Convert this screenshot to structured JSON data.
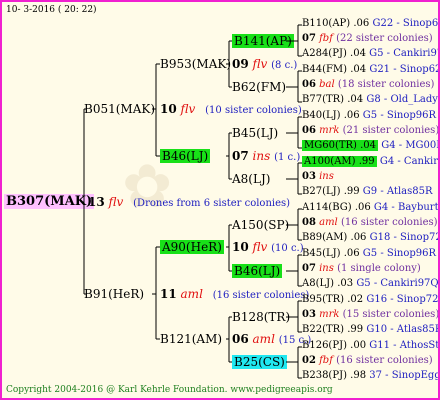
{
  "date": "10-  3-2016 ( 20: 22)",
  "root": {
    "id": "B307(MAK)",
    "num": "13",
    "code": "flv",
    "note": "(Drones from 6 sister colonies)"
  },
  "gen1": [
    {
      "id": "B051(MAK)",
      "num": "10",
      "code": "flv",
      "note": "(10 sister colonies)"
    },
    {
      "id": "B91(HeR)",
      "num": "11",
      "code": "aml",
      "note": "(16 sister colonies)"
    }
  ],
  "gen2": [
    {
      "id": "B953(MAK)",
      "num": "09",
      "code": "flv",
      "note": "(8 c.)"
    },
    {
      "id": "B46(LJ)",
      "num": "07",
      "code": "ins",
      "note": "(1 c.)"
    },
    {
      "id": "A90(HeR)",
      "num": "10",
      "code": "flv",
      "note": "(10 c.)"
    },
    {
      "id": "B121(AM)",
      "num": "06",
      "code": "aml",
      "note": "(15 c.)"
    }
  ],
  "gen3": [
    {
      "id": "B141(AP)"
    },
    {
      "id": "B62(FM)"
    },
    {
      "id": "B45(LJ)"
    },
    {
      "id": "A8(LJ)"
    },
    {
      "id": "A150(SP)"
    },
    {
      "id": "B46(LJ)"
    },
    {
      "id": "B128(TR)"
    },
    {
      "id": "B25(CS)"
    }
  ],
  "gen4": [
    {
      "l1": "B110(AP) .06",
      "l1b": "G22 - Sinop62R",
      "num": "07",
      "code": "fbf",
      "note": "(22 sister colonies)",
      "l3": "A284(PJ) .04",
      "l3b": "G5 - Cankiri97Q"
    },
    {
      "l1": "B44(FM) .04",
      "l1b": "G21 - Sinop62R",
      "num": "06",
      "code": "bal",
      "note": "(18 sister colonies)",
      "l3": "B77(TR) .04",
      "l3b": "G8 - Old_Lady"
    },
    {
      "l1": "B40(LJ) .06",
      "l1b": "G5 - Sinop96R",
      "num": "06",
      "code": "mrk",
      "note": "(21 sister colonies)",
      "l3": "MG60(TR) .04",
      "l3b": "G4 - MG00R"
    },
    {
      "l1": "A100(AM) .99",
      "l1b": "G4 - Cankiri97Q",
      "num": "03",
      "code": "ins",
      "note": "",
      "l3": "B27(LJ) .99",
      "l3b": "G9 - Atlas85R"
    },
    {
      "l1": "A114(BG) .06",
      "l1b": "G4 - Bayburt98-3",
      "num": "08",
      "code": "aml",
      "note": "(16 sister colonies)",
      "l3": "B89(AM) .06",
      "l3b": "G18 - Sinop72R"
    },
    {
      "l1": "B45(LJ) .06",
      "l1b": "G5 - Sinop96R",
      "num": "07",
      "code": "ins",
      "note": "(1 single colony)",
      "l3": "A8(LJ) .03",
      "l3b": "G5 - Cankiri97Q"
    },
    {
      "l1": "B95(TR) .02",
      "l1b": "G16 - Sinop72R",
      "num": "03",
      "code": "mrk",
      "note": "(15 sister colonies)",
      "l3": "B22(TR) .99",
      "l3b": "G10 - Atlas85R"
    },
    {
      "l1": "B126(PJ) .00",
      "l1b": "G11 - AthosSt80R",
      "num": "02",
      "code": "fbf",
      "note": "(16 sister colonies)",
      "l3": "B238(PJ) .98",
      "l3b": "37 - SinopEgg86R"
    }
  ],
  "footer": "Copyright 2004-2016 @ Karl Kehrle Foundation.   www.pedigreeapis.org"
}
